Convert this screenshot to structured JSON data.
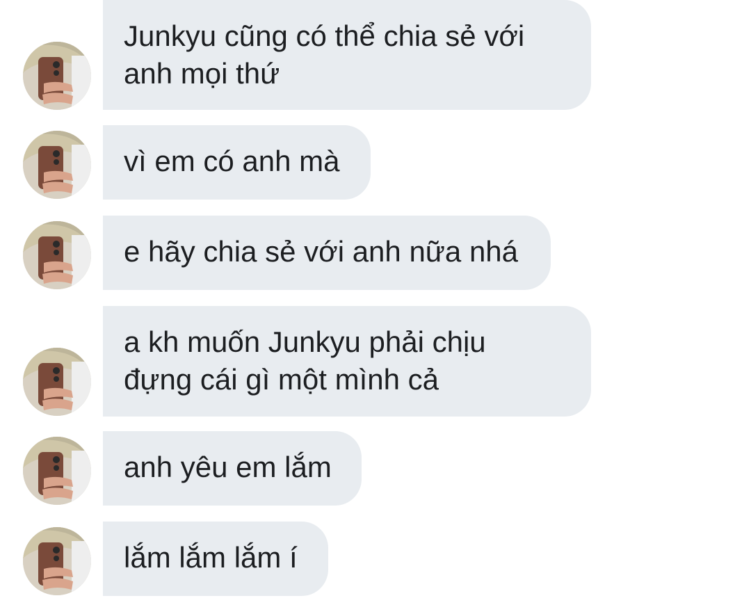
{
  "colors": {
    "background": "#ffffff",
    "bubble": "#e8ecf0",
    "text": "#1c1e21"
  },
  "messages": [
    {
      "text": "Junkyu cũng có thể chia sẻ với\nanh mọi thứ"
    },
    {
      "text": "vì em có anh mà"
    },
    {
      "text": "e hãy chia sẻ với anh nữa nhá"
    },
    {
      "text": "a kh muốn Junkyu phải chịu\nđựng cái gì một mình cả"
    },
    {
      "text": "anh yêu em lắm"
    },
    {
      "text": "lắm lắm lắm í"
    }
  ],
  "avatar_icon": "profile-photo"
}
